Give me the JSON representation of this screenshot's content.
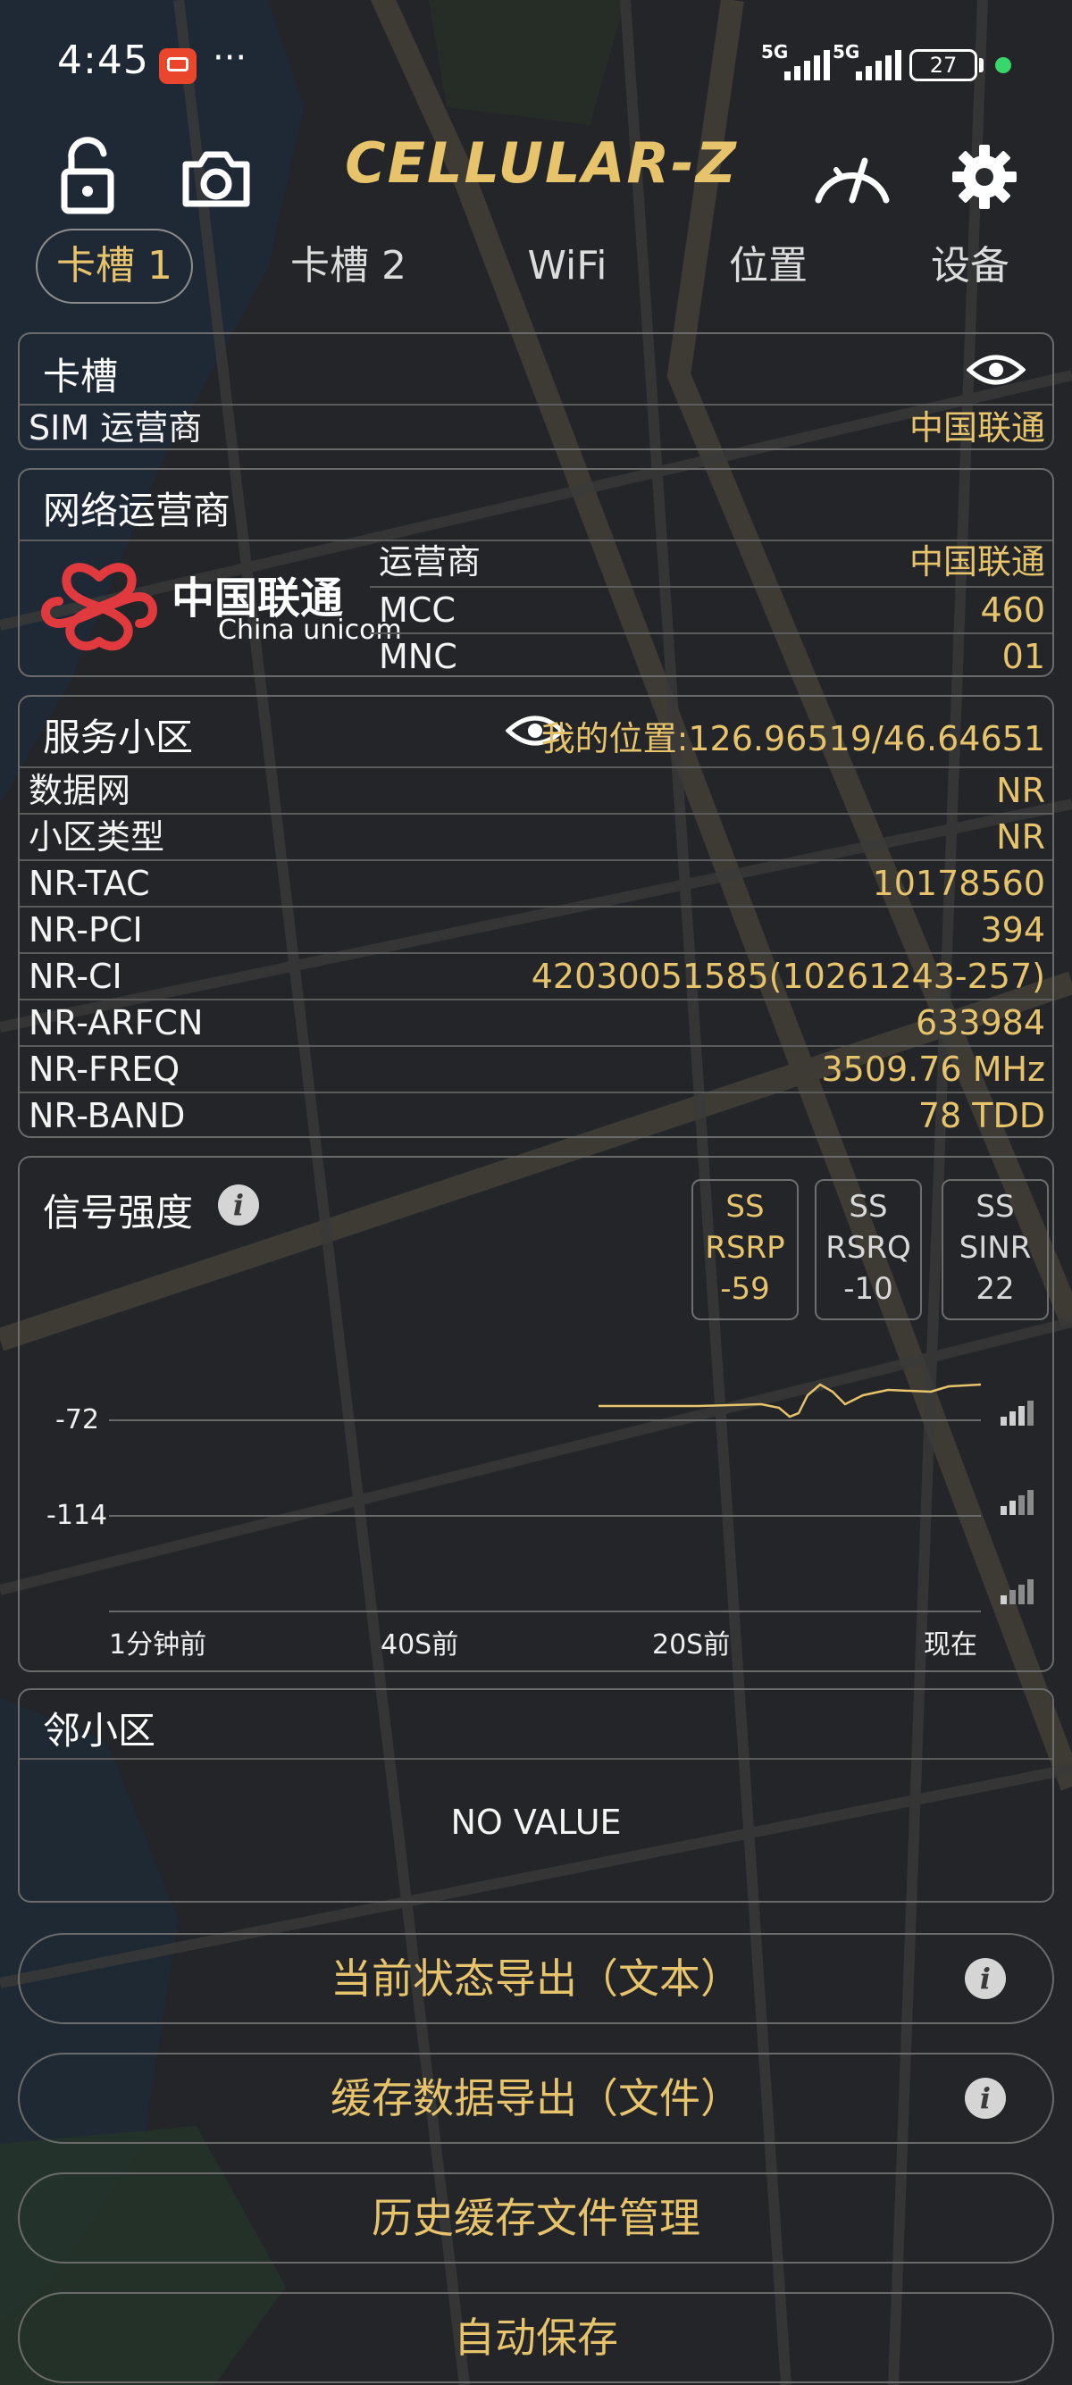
{
  "status": {
    "time": "4:45",
    "more": "···",
    "sim1_network": "5G",
    "sim2_network": "5G",
    "battery": "27"
  },
  "header": {
    "brand": "CELLULAR-Z"
  },
  "tabs": [
    "卡槽 1",
    "卡槽 2",
    "WiFi",
    "位置",
    "设备"
  ],
  "slot_card": {
    "title": "卡槽",
    "sim_operator_label": "SIM 运营商",
    "sim_operator_value": "中国联通"
  },
  "network_card": {
    "title": "网络运营商",
    "logo_cn": "中国联通",
    "logo_en": "China unicom",
    "rows": [
      {
        "label": "运营商",
        "value": "中国联通"
      },
      {
        "label": "MCC",
        "value": "460"
      },
      {
        "label": "MNC",
        "value": "01"
      }
    ]
  },
  "serving_card": {
    "title": "服务小区",
    "location": "我的位置:126.96519/46.64651",
    "rows": [
      {
        "label": "数据网",
        "value": "NR"
      },
      {
        "label": "小区类型",
        "value": "NR"
      },
      {
        "label": "NR-TAC",
        "value": "10178560"
      },
      {
        "label": "NR-PCI",
        "value": "394"
      },
      {
        "label": "NR-CI",
        "value": "42030051585(10261243-257)"
      },
      {
        "label": "NR-ARFCN",
        "value": "633984"
      },
      {
        "label": "NR-FREQ",
        "value": "3509.76 MHz"
      },
      {
        "label": "NR-BAND",
        "value": "78 TDD"
      }
    ]
  },
  "signal_card": {
    "title": "信号强度",
    "chips": [
      {
        "line1": "SS",
        "line2": "RSRP",
        "value": "-59"
      },
      {
        "line1": "SS",
        "line2": "RSRQ",
        "value": "-10"
      },
      {
        "line1": "SS",
        "line2": "SINR",
        "value": "22"
      }
    ],
    "y_ticks": [
      "-72",
      "-114"
    ],
    "x_ticks": [
      "1分钟前",
      "40S前",
      "20S前",
      "现在"
    ]
  },
  "neighbor_card": {
    "title": "邻小区",
    "empty_text": "NO VALUE"
  },
  "buttons": [
    "当前状态导出（文本）",
    "缓存数据导出（文件）",
    "历史缓存文件管理",
    "自动保存"
  ],
  "info_glyph": "i",
  "colors": {
    "accent": "#e7c46c",
    "background": "#222427",
    "border": "#6b6b6b"
  }
}
